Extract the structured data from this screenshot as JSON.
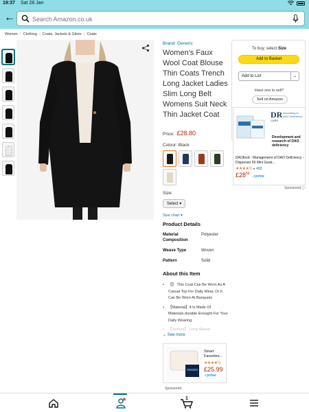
{
  "status_bar": {
    "time": "19:37",
    "date": "Sat 28 Jan"
  },
  "search": {
    "placeholder": "Search Amazon.co.uk"
  },
  "breadcrumb": [
    "Women",
    "Clothing",
    "Coats, Jackets & Gilets",
    "Coats"
  ],
  "product": {
    "brand": "Brand: Generic",
    "title": "Women's Faux Wool Coat Blouse Thin Coats Trench Long Jacket Ladies Slim Long Belt Womens Suit Neck Thin Jacket Coat",
    "price_label": "Price:",
    "price": "£28.80",
    "colour_label": "Colour:",
    "colour_value": "Black",
    "size_label": "Size:",
    "size_select": "Select",
    "size_chart": "Size chart",
    "details_heading": "Product Details",
    "details": [
      {
        "label": "Material Composition",
        "value": "Polyester"
      },
      {
        "label": "Weave Type",
        "value": "Woven"
      },
      {
        "label": "Pattern",
        "value": "Solid"
      }
    ],
    "about_heading": "About this Item",
    "bullets": [
      "【】 This Coat Can Be Worn As A Casual Top For Daily Wear, Or It Can Be Worn At Banquets",
      "【Material】It Is Made Of Materials,durable Enought For Your Daily Wearing",
      "【Texture】 Long Sleeve"
    ],
    "see_more": "See more",
    "swatch_colors": [
      "#1a1a1a",
      "#1f3a5f",
      "#9b3b1e",
      "#2c3d25",
      "#e4d8c6"
    ]
  },
  "buy_box": {
    "to_buy_prefix": "To buy, select",
    "to_buy_bold": "Size",
    "add_to_basket": "Add to Basket",
    "add_to_list": "Add to List",
    "have_one": "Have one to sell?",
    "sell_on_amazon": "Sell on Amazon"
  },
  "sponsored_ad_1": {
    "logo_text": "DR",
    "logo_sub": "CARE",
    "logo_tagline": "Innovating in DAO Deficiency",
    "headline": "Development and research of DAO deficiency",
    "description": "DAOfood - Management of DAO Deficiency - Dispenser 60 Mini Gastr...",
    "stars": "★★★★½",
    "rating_count": "493",
    "price_whole": "28",
    "price_fraction": "50",
    "prime": "prime",
    "sponsored": "Sponsored"
  },
  "sponsored_ad_2": {
    "title": "Smart Favorites...",
    "stars": "★★★★½",
    "price": "£25.99",
    "prime": "prime",
    "sponsored": "Sponsored"
  },
  "bottom_nav": {
    "cart_count": "1"
  },
  "colors": {
    "header_bg": "#8fdde6",
    "accent": "#007185",
    "price": "#b12704",
    "button": "#ffd814"
  }
}
